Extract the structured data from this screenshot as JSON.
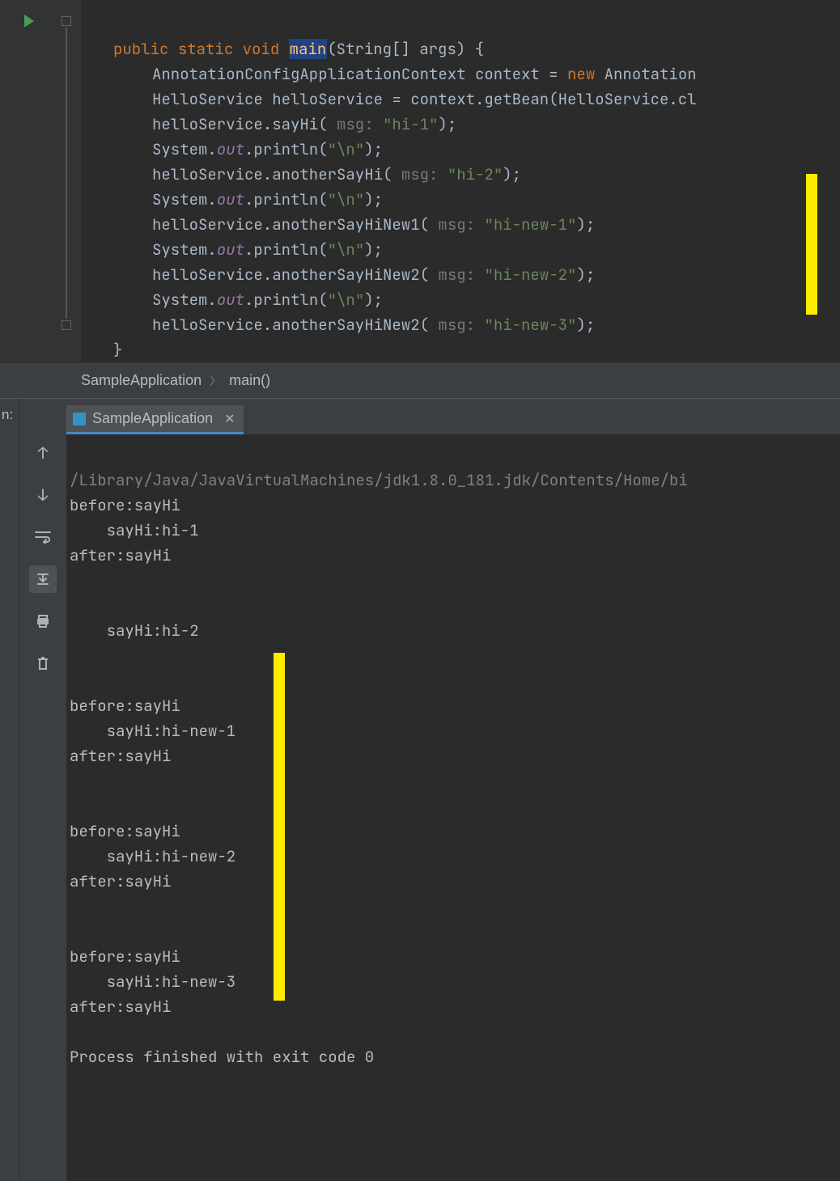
{
  "editor": {
    "signature": {
      "public": "public",
      "static": "static",
      "void": "void",
      "main": "main",
      "params": "(String[] args) {"
    },
    "lines": {
      "l1a": "AnnotationConfigApplicationContext context = ",
      "l1new": "new",
      "l1b": " Annotation",
      "l2": "HelloService helloService = context.getBean(HelloService.cl",
      "l3a": "helloService.sayHi(",
      "l3h": " msg: ",
      "l3s": "\"hi-1\"",
      "l3c": ");",
      "l4a": "System.",
      "l4f": "out",
      "l4b": ".println(",
      "l4s": "\"\\n\"",
      "l4c": ");",
      "l5a": "helloService.anotherSayHi(",
      "l5h": " msg: ",
      "l5s": "\"hi-2\"",
      "l5c": ");",
      "l6a": "System.",
      "l6f": "out",
      "l6b": ".println(",
      "l6s": "\"\\n\"",
      "l6c": ");",
      "l7a": "helloService.anotherSayHiNew1(",
      "l7h": " msg: ",
      "l7s": "\"hi-new-1\"",
      "l7c": ");",
      "l8a": "System.",
      "l8f": "out",
      "l8b": ".println(",
      "l8s": "\"\\n\"",
      "l8c": ");",
      "l9a": "helloService.anotherSayHiNew2(",
      "l9h": " msg: ",
      "l9s": "\"hi-new-2\"",
      "l9c": ");",
      "l10a": "System.",
      "l10f": "out",
      "l10b": ".println(",
      "l10s": "\"\\n\"",
      "l10c": ");",
      "l11a": "helloService.anotherSayHiNew2(",
      "l11h": " msg: ",
      "l11s": "\"hi-new-3\"",
      "l11c": ");",
      "close1": "}",
      "close2": "}"
    }
  },
  "breadcrumb": {
    "item1": "SampleApplication",
    "item2": "main()"
  },
  "run": {
    "label": "n:",
    "tab": "SampleApplication"
  },
  "console": {
    "cmd": "/Library/Java/JavaVirtualMachines/jdk1.8.0_181.jdk/Contents/Home/bi",
    "l1": "before:sayHi",
    "l2": "    sayHi:hi-1",
    "l3": "after:sayHi",
    "l4": "",
    "l5": "",
    "l6": "    sayHi:hi-2",
    "l7": "",
    "l8": "",
    "l9": "before:sayHi",
    "l10": "    sayHi:hi-new-1",
    "l11": "after:sayHi",
    "l12": "",
    "l13": "",
    "l14": "before:sayHi",
    "l15": "    sayHi:hi-new-2",
    "l16": "after:sayHi",
    "l17": "",
    "l18": "",
    "l19": "before:sayHi",
    "l20": "    sayHi:hi-new-3",
    "l21": "after:sayHi",
    "l22": "",
    "l23": "Process finished with exit code 0"
  }
}
